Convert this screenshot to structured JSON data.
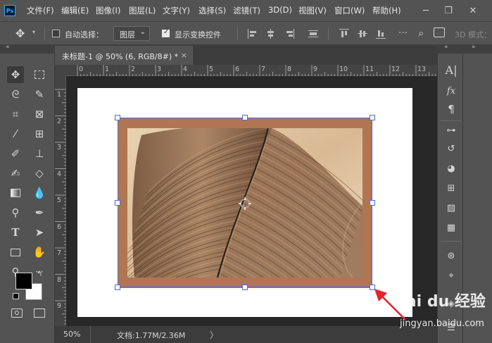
{
  "app": {
    "logo": "Ps"
  },
  "menu": {
    "items": [
      "文件(F)",
      "编辑(E)",
      "图像(I)",
      "图层(L)",
      "文字(Y)",
      "选择(S)",
      "滤镜(T)",
      "3D(D)",
      "视图(V)",
      "窗口(W)",
      "帮助(H)"
    ]
  },
  "options": {
    "auto_select_label": "自动选择：",
    "layer_select_value": "图层",
    "show_transform_label": "显示变换控件",
    "mode_3d_label": "3D 模式："
  },
  "document": {
    "tab_title": "未标题-1 @ 50% (6, RGB/8#) *",
    "close_glyph": "×"
  },
  "rulers": {
    "top": [
      "0",
      "1",
      "2",
      "3",
      "4",
      "5",
      "6",
      "7",
      "8",
      "9",
      "10",
      "11",
      "12",
      "13"
    ],
    "left": [
      "1",
      "2",
      "3",
      "4",
      "5",
      "6",
      "7",
      "8",
      "9"
    ]
  },
  "status": {
    "zoom": "50%",
    "doc_info": "文档:1.77M/2.36M",
    "arrow": "〉"
  },
  "watermark": {
    "logo": "Bai du 经验",
    "url": "jingyan.baidu.com"
  },
  "colors": {
    "accent": "#31a8ff",
    "frame": "#b07652",
    "selection": "#4d6bd8",
    "annotation_arrow": "#e8222a"
  }
}
